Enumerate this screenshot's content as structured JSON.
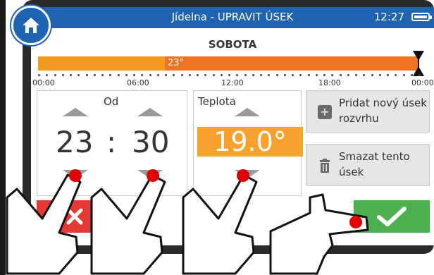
{
  "titlebar": {
    "title": "Jídelna - UPRAVIT ÚSEK",
    "time": "12:27",
    "accent_color": "#1f63b3"
  },
  "home_icon": "home-icon",
  "day": "SOBOTA",
  "timeline": {
    "segment_label": "23°",
    "hours": [
      "00:00",
      "06:00",
      "12:00",
      "18:00",
      "00:00"
    ]
  },
  "from_panel": {
    "label": "Od",
    "hour": "23",
    "separator": ":",
    "minute": "30"
  },
  "temperature_panel": {
    "label": "Teplota",
    "value": "19.0°"
  },
  "actions": {
    "add_label": "Pridat nový úsek rozvrhu",
    "delete_label": "Smazat tento úsek"
  },
  "colors": {
    "cancel": "#e53935",
    "confirm": "#4caf50",
    "orange": "#f39a20",
    "orange_dark": "#f07222"
  }
}
